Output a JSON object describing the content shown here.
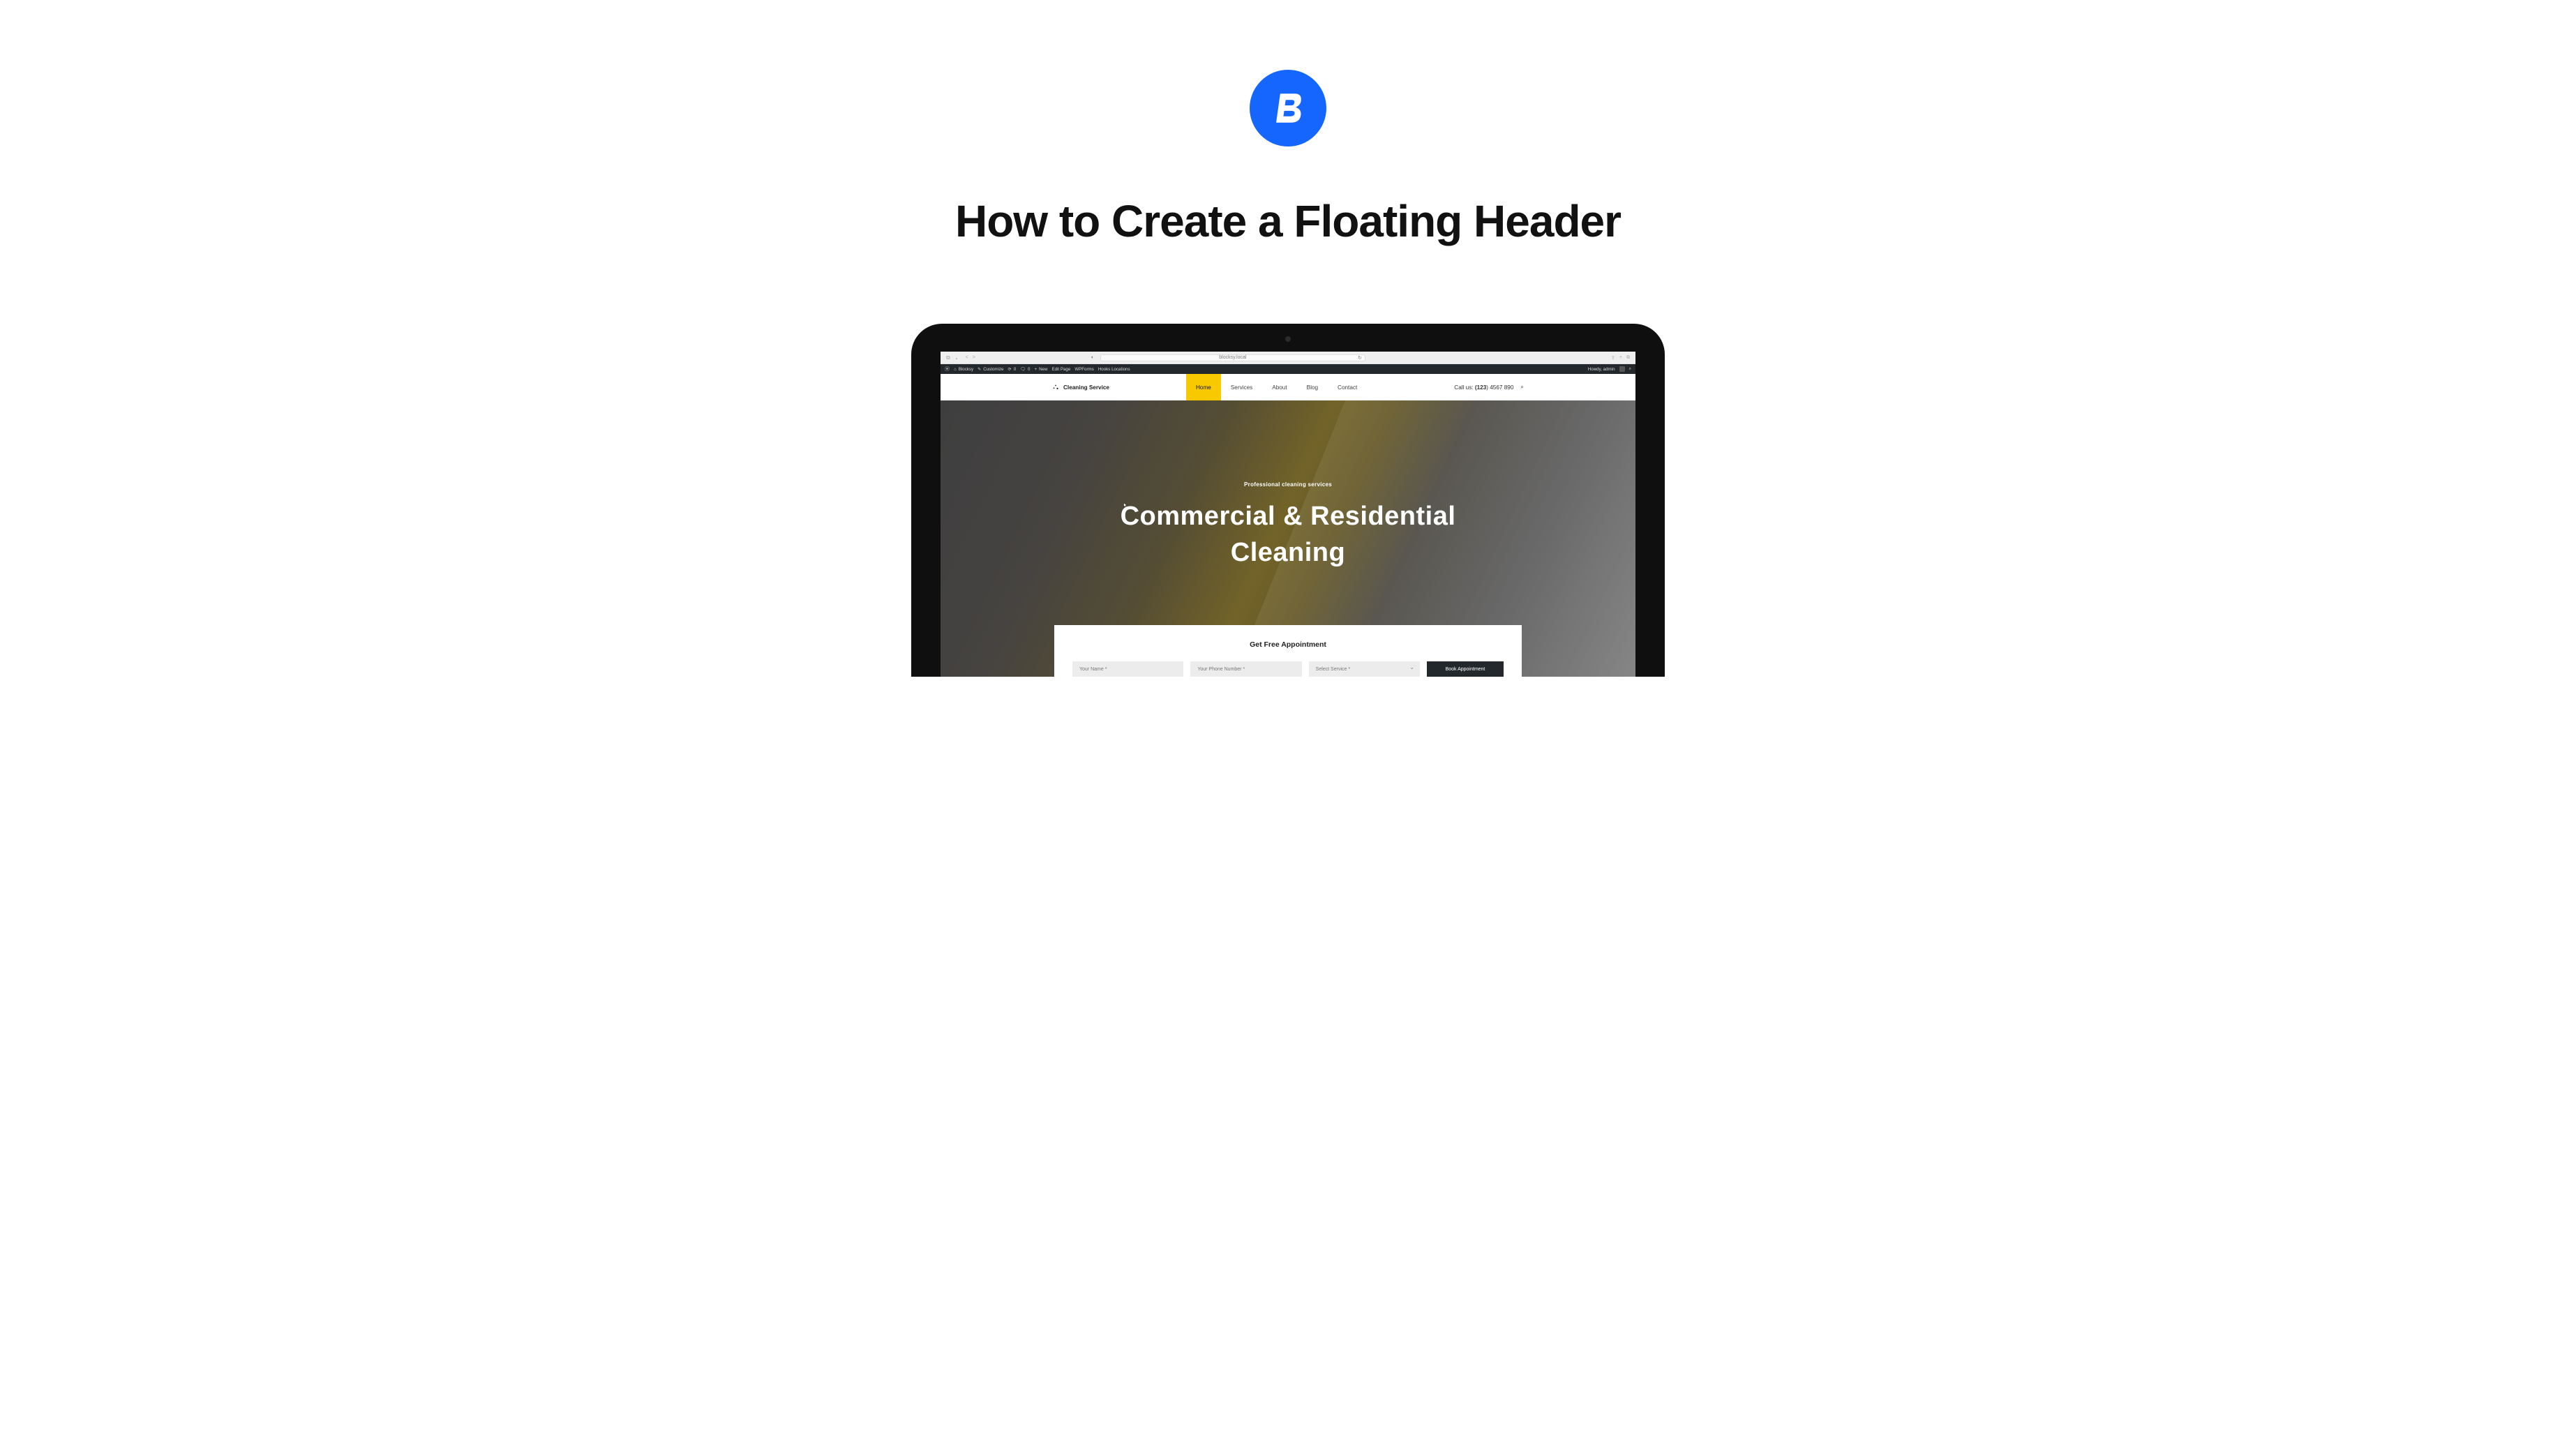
{
  "page": {
    "title": "How to Create a Floating Header"
  },
  "browser": {
    "url": "blocksy.local"
  },
  "wp_bar": {
    "site_name": "Blocksy",
    "customize": "Customize",
    "updates_count": "0",
    "comments_count": "0",
    "new": "New",
    "edit_page": "Edit Page",
    "wpforms": "WPForms",
    "hooks": "Hooks Locations",
    "howdy": "Howdy, admin"
  },
  "site": {
    "name": "Cleaning Service",
    "nav": {
      "home": "Home",
      "services": "Services",
      "about": "About",
      "blog": "Blog",
      "contact": "Contact"
    },
    "call_label": "Call us: ",
    "call_prefix": "(123",
    "call_rest": ") 4567 890"
  },
  "hero": {
    "eyebrow": "Professional cleaning services",
    "line1": "Commercial & Residential",
    "line2": "Cleaning"
  },
  "form": {
    "title": "Get Free Appointment",
    "name_placeholder": "Your Name *",
    "phone_placeholder": "Your Phone Number *",
    "service_placeholder": "Select Service *",
    "submit": "Book Appointment"
  }
}
